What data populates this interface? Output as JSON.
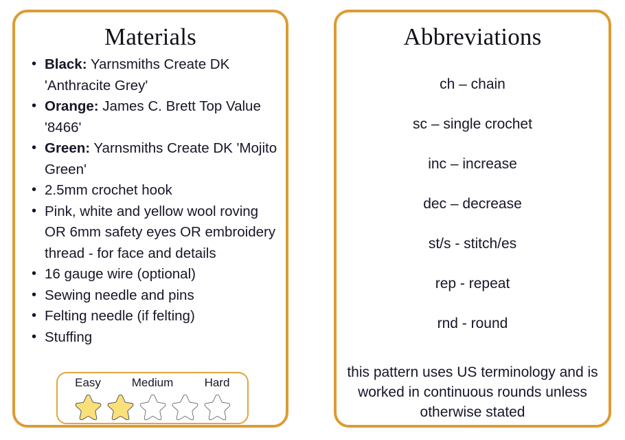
{
  "materials": {
    "title": "Materials",
    "items": [
      {
        "label": "Black:",
        "text": " Yarnsmiths Create DK 'Anthracite Grey'"
      },
      {
        "label": "Orange:",
        "text": " James C. Brett Top Value '8466'"
      },
      {
        "label": "Green:",
        "text": " Yarnsmiths Create DK 'Mojito Green'"
      },
      {
        "label": "",
        "text": "2.5mm crochet hook"
      },
      {
        "label": "",
        "text": "Pink, white and yellow wool roving OR 6mm safety eyes OR embroidery thread - for face and details"
      },
      {
        "label": "",
        "text": "16 gauge wire (optional)"
      },
      {
        "label": "",
        "text": "Sewing needle and pins"
      },
      {
        "label": "",
        "text": "Felting needle (if felting)"
      },
      {
        "label": "",
        "text": "Stuffing"
      }
    ],
    "difficulty": {
      "labels": [
        "Easy",
        "Medium",
        "Hard"
      ],
      "total_stars": 5,
      "filled_stars": 2,
      "filled_color": "#fbe07a",
      "empty_color": "#ffffff",
      "outline_color": "#4a4a52",
      "box_border_color": "#e2a53c"
    }
  },
  "abbreviations": {
    "title": "Abbreviations",
    "lines": [
      "ch – chain",
      "sc – single crochet",
      "inc – increase",
      "dec – decrease",
      "st/s - stitch/es",
      "rep - repeat",
      "rnd - round"
    ],
    "note": "this pattern uses US terminology and is worked in continuous rounds unless otherwise stated"
  },
  "theme": {
    "card_border_color": "#dd9b33",
    "text_color": "#161628",
    "background": "#ffffff"
  }
}
